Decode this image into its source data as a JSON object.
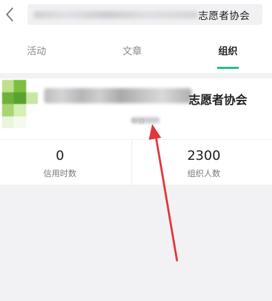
{
  "header": {
    "back_icon": "chevron-left-icon",
    "search_text": "志愿者协会"
  },
  "tabs": [
    {
      "label": "活动",
      "active": false
    },
    {
      "label": "文章",
      "active": false
    },
    {
      "label": "组织",
      "active": true
    }
  ],
  "colors": {
    "accent": "#1fbf8f",
    "annotation_arrow": "#e3363c"
  },
  "organization": {
    "name_visible": "志愿者协会",
    "subtitle": "申请"
  },
  "stats": [
    {
      "value": "0",
      "label": "信用时数"
    },
    {
      "value": "2300",
      "label": "组织人数"
    }
  ]
}
